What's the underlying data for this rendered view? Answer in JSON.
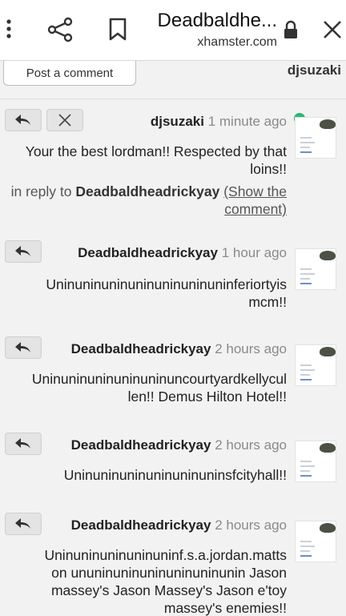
{
  "header": {
    "title": "Deadbaldhe...",
    "url": "xhamster.com"
  },
  "composer": {
    "post_label": "Post a comment",
    "username": "djsuzaki"
  },
  "comments": [
    {
      "author": "djsuzaki",
      "time": "1 minute ago",
      "lines": [
        "Your the best lordman!! Respected by that",
        "loins!!"
      ],
      "reply_prefix": "in reply to",
      "reply_to": "Deadbaldheadrickyay",
      "reply_link_1": "(Show the",
      "reply_link_2": "comment)",
      "online": true
    },
    {
      "author": "Deadbaldheadrickyay",
      "time": "1 hour ago",
      "lines": [
        "Uninuninuninuninuninuninuninferiortyis",
        "mcm!!"
      ]
    },
    {
      "author": "Deadbaldheadrickyay",
      "time": "2 hours ago",
      "lines": [
        "Uninuninuninuninuninuncourtyardkellycul",
        "len!! Demus Hilton Hotel!!"
      ]
    },
    {
      "author": "Deadbaldheadrickyay",
      "time": "2 hours ago",
      "lines": [
        "Uninuninuninuninuninuninsfcityhall!!"
      ]
    },
    {
      "author": "Deadbaldheadrickyay",
      "time": "2 hours ago",
      "lines": [
        "Uninuninuninuninuninf.s.a.jordan.matts",
        "on ununinuninuninuninuninunin Jason",
        "massey's Jason Massey's Jason e'toy",
        "massey's enemies!!"
      ]
    }
  ],
  "icons": {
    "menu": "kebab-menu-icon",
    "share": "share-icon",
    "bookmark": "bookmark-icon",
    "lock": "lock-icon",
    "close": "close-icon",
    "reply": "reply-arrow-icon",
    "dismiss": "x-icon"
  },
  "colors": {
    "online": "#2bb673",
    "background": "#f2f2f2"
  }
}
